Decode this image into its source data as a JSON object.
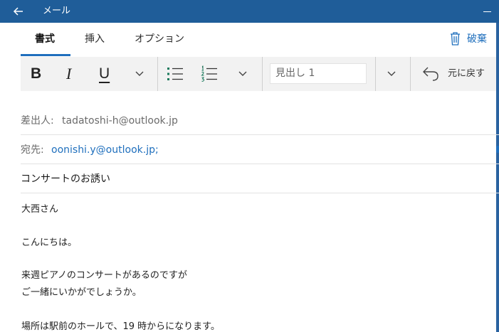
{
  "window": {
    "title": "メール"
  },
  "tabs": [
    {
      "label": "書式",
      "active": true
    },
    {
      "label": "挿入",
      "active": false
    },
    {
      "label": "オプション",
      "active": false
    }
  ],
  "discard": {
    "label": "破棄",
    "icon": "trash-icon"
  },
  "toolbar": {
    "bold_label": "B",
    "italic_label": "I",
    "underline_label": "U",
    "style_value": "見出し 1",
    "undo_label": "元に戻す"
  },
  "from": {
    "label": "差出人:",
    "value": "tadatoshi-h@outlook.jp"
  },
  "to": {
    "label": "宛先:",
    "value": "oonishi.y@outlook.jp;"
  },
  "subject": {
    "value": "コンサートのお誘い"
  },
  "body": {
    "lines": [
      "大西さん",
      "こんにちは。",
      "来週ピアノのコンサートがあるのですが",
      "ご一緒にいかがでしょうか。",
      "場所は駅前のホールで、19 時からになります。"
    ]
  },
  "colors": {
    "titlebar": "#1f5d99",
    "accent": "#1f6fbd",
    "toolbar_bg": "#f2f2f2"
  }
}
